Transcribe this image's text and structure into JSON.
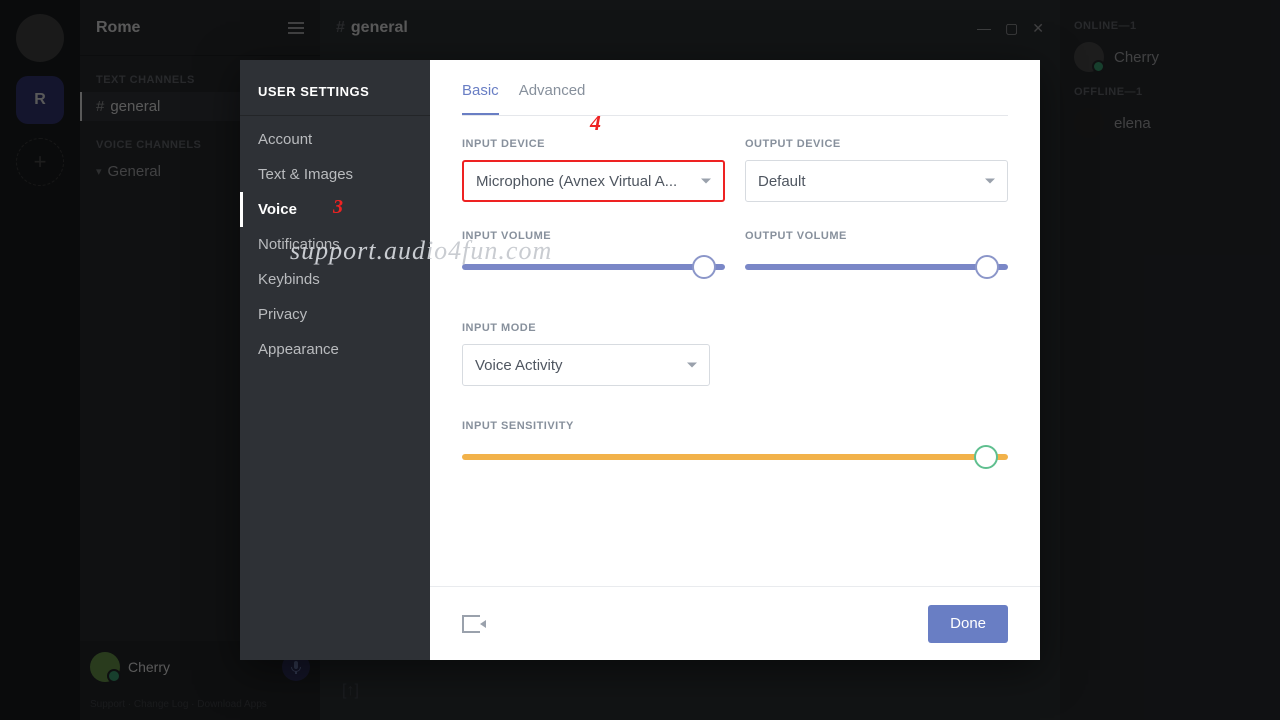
{
  "server": {
    "name": "Rome"
  },
  "channel_sections": {
    "text_label": "TEXT CHANNELS",
    "voice_label": "VOICE CHANNELS",
    "text_items": [
      {
        "name": "general",
        "active": true
      }
    ],
    "voice_items": [
      {
        "name": "General"
      }
    ]
  },
  "chat": {
    "title_prefix": "#",
    "title": "general"
  },
  "user": {
    "name": "Cherry"
  },
  "footer_links": "Support  ·  Change Log  ·  Download Apps",
  "members": {
    "online_label": "ONLINE—1",
    "offline_label": "OFFLINE—1",
    "online": [
      {
        "name": "Cherry"
      }
    ],
    "offline": [
      {
        "name": "elena"
      }
    ]
  },
  "settings": {
    "title": "USER SETTINGS",
    "items": [
      "Account",
      "Text & Images",
      "Voice",
      "Notifications",
      "Keybinds",
      "Privacy",
      "Appearance"
    ],
    "active_index": 2,
    "annot3": "3",
    "tabs": {
      "basic": "Basic",
      "advanced": "Advanced",
      "active": 0
    },
    "labels": {
      "input_device": "INPUT DEVICE",
      "output_device": "OUTPUT DEVICE",
      "input_volume": "INPUT VOLUME",
      "output_volume": "OUTPUT VOLUME",
      "input_mode": "INPUT MODE",
      "input_sensitivity": "INPUT SENSITIVITY"
    },
    "values": {
      "input_device": "Microphone (Avnex Virtual A...",
      "output_device": "Default",
      "input_mode": "Voice Activity",
      "input_volume_pct": 92,
      "output_volume_pct": 92,
      "sensitivity_pct": 96
    },
    "annot4": "4",
    "done": "Done"
  },
  "watermark": "support.audio4fun.com",
  "guild_initial": "R",
  "colors": {
    "accent": "#697ec4",
    "highlight_red": "#e22",
    "sens_track": "#f2b24a"
  }
}
